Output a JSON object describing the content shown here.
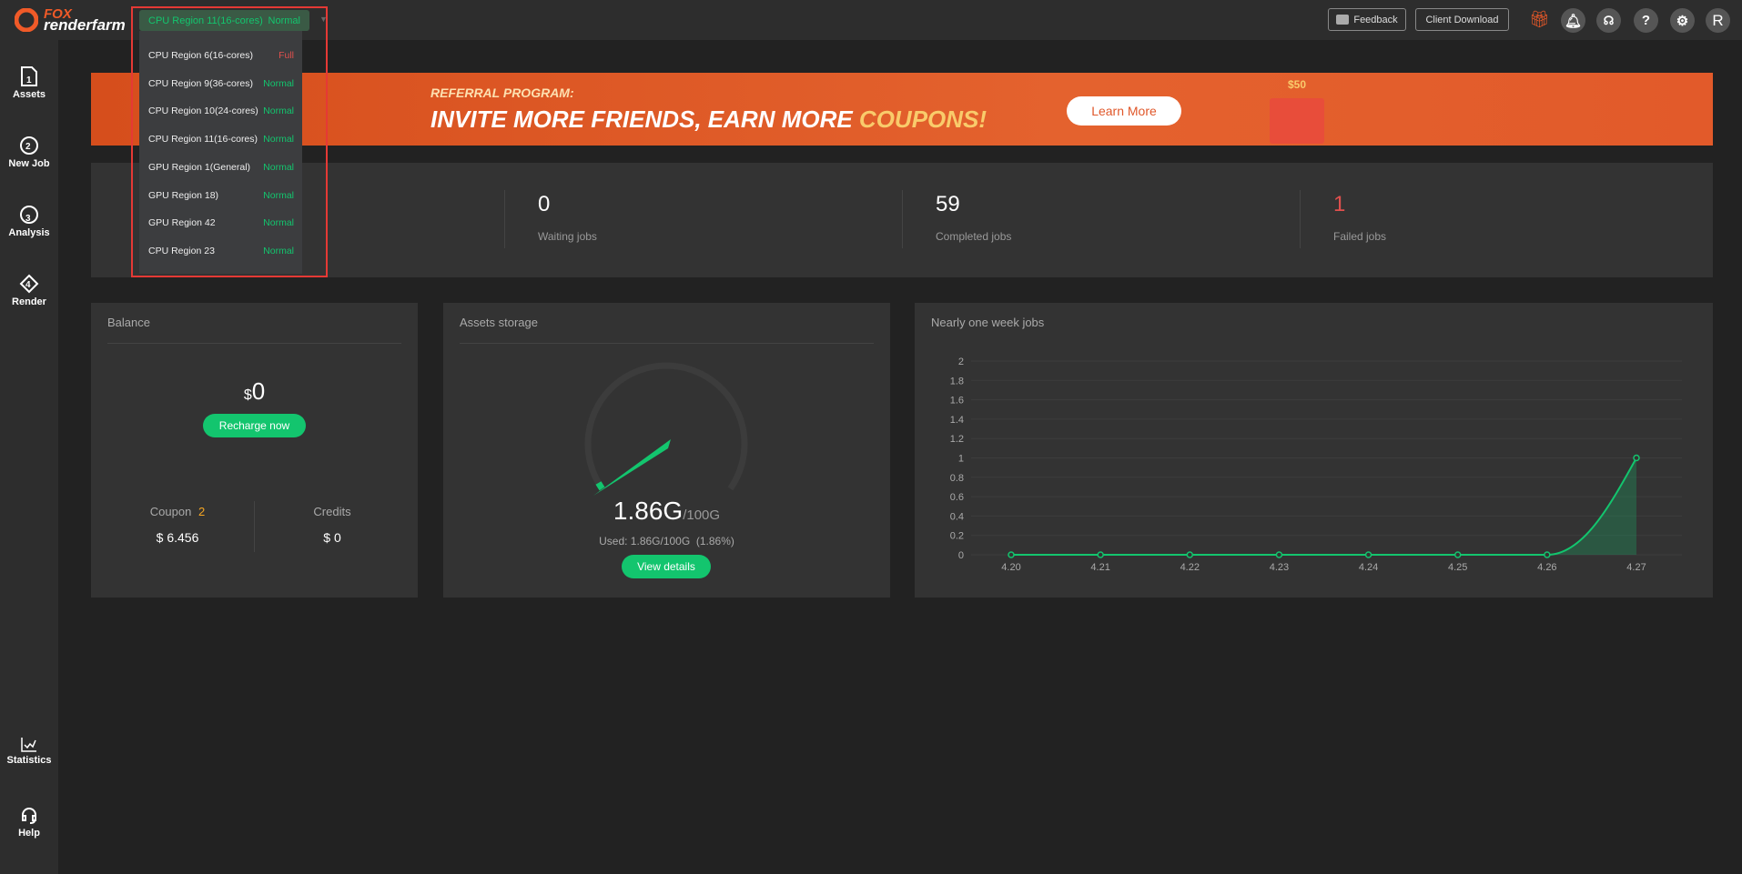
{
  "brand": {
    "logo_top": "FOX",
    "logo_bottom": "renderfarm"
  },
  "region_selector": {
    "selected": "CPU Region 11(16-cores)",
    "selected_status": "Normal",
    "options": [
      {
        "label": "CPU Region 6(16-cores)",
        "status": "Full"
      },
      {
        "label": "CPU Region 9(36-cores)",
        "status": "Normal"
      },
      {
        "label": "CPU Region 10(24-cores)",
        "status": "Normal"
      },
      {
        "label": "CPU Region 11(16-cores)",
        "status": "Normal"
      },
      {
        "label": "GPU Region 1(General)",
        "status": "Normal"
      },
      {
        "label": "GPU Region 18)",
        "status": "Normal"
      },
      {
        "label": "GPU Region 42",
        "status": "Normal"
      },
      {
        "label": "CPU Region 23",
        "status": "Normal"
      }
    ]
  },
  "header": {
    "feedback": "Feedback",
    "client_download": "Client Download",
    "avatar": "R",
    "help": "?"
  },
  "sidebar": {
    "items": [
      {
        "label": "Assets",
        "num": "1"
      },
      {
        "label": "New Job",
        "num": "2"
      },
      {
        "label": "Analysis",
        "num": "3"
      },
      {
        "label": "Render",
        "num": "4"
      },
      {
        "label": "Statistics"
      },
      {
        "label": "Help"
      }
    ]
  },
  "banner": {
    "kicker": "REFERRAL PROGRAM:",
    "headline": "INVITE MORE FRIENDS, EARN MORE ",
    "highlight": "COUPONS!",
    "cta": "Learn More",
    "coupon_text": "$50"
  },
  "stats": [
    {
      "value": "0",
      "label": "Waiting jobs"
    },
    {
      "value": "59",
      "label": "Completed jobs"
    },
    {
      "value": "1",
      "label": "Failed jobs"
    }
  ],
  "balance": {
    "title": "Balance",
    "currency": "$",
    "amount": "0",
    "recharge": "Recharge now",
    "coupon_label": "Coupon",
    "coupon_count": "2",
    "coupon_value": "$ 6.456",
    "credits_label": "Credits",
    "credits_value": "$ 0"
  },
  "storage": {
    "title": "Assets storage",
    "used": "1.86G",
    "total": "/100G",
    "used_text": "Used: 1.86G/100G  (1.86%)",
    "fraction": 0.0186,
    "view": "View details"
  },
  "colors": {
    "accent": "#13c56e",
    "danger": "#e0504e",
    "brand": "#f05a28",
    "coupon": "#f5a623"
  },
  "chart_data": {
    "type": "area",
    "title": "Nearly one week jobs",
    "categories": [
      "4.20",
      "4.21",
      "4.22",
      "4.23",
      "4.24",
      "4.25",
      "4.26",
      "4.27"
    ],
    "values": [
      0,
      0,
      0,
      0,
      0,
      0,
      0,
      1
    ],
    "ylim": [
      0,
      2
    ],
    "yticks": [
      "0",
      "0.2",
      "0.4",
      "0.6",
      "0.8",
      "1",
      "1.2",
      "1.4",
      "1.6",
      "1.8",
      "2"
    ],
    "grid": true
  }
}
